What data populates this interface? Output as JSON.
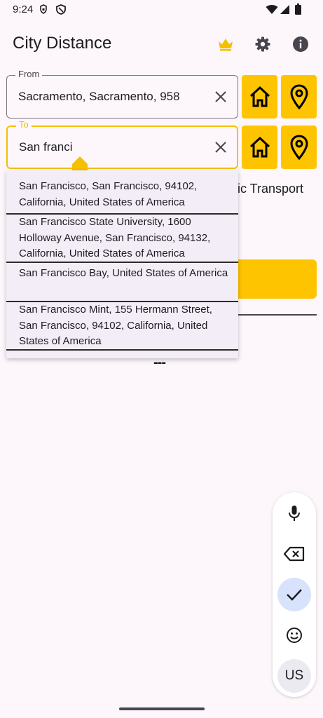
{
  "status_bar": {
    "time": "9:24",
    "icons": [
      "lock-shield-icon",
      "vpn-shield-icon",
      "wifi-icon",
      "cell-signal-icon",
      "battery-icon"
    ]
  },
  "app_bar": {
    "title": "City Distance",
    "actions": [
      "crown-icon",
      "gear-icon",
      "info-icon"
    ]
  },
  "from_field": {
    "label": "From",
    "value": "Sacramento, Sacramento, 958"
  },
  "to_field": {
    "label": "To",
    "value": "San franci"
  },
  "side_buttons": [
    "home-icon",
    "map-pin-icon"
  ],
  "background": {
    "transport_text": "lic Transport",
    "dash": "---"
  },
  "suggestions": [
    "San Francisco, San Francisco, 94102, California, United States of America",
    "San Francisco State University, 1600 Holloway Avenue, San Francisco, 94132, California, United States of America",
    "San Francisco Bay, United States of America",
    "San Francisco Mint, 155 Hermann Street, San Francisco, 94102, California, United States of America"
  ],
  "voice_toolbar": {
    "buttons": [
      "mic-icon",
      "backspace-icon",
      "check-icon",
      "emoji-icon"
    ],
    "language": "US"
  },
  "colors": {
    "accent": "#ffc400",
    "background": "#fdf7fb",
    "dropdown": "#f3edf7"
  }
}
